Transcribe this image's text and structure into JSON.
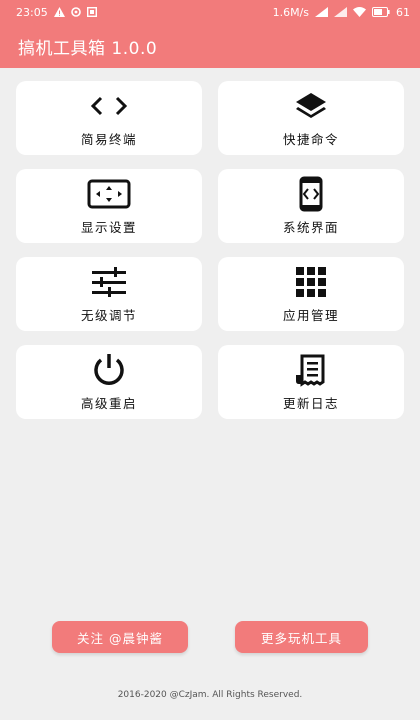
{
  "status_bar": {
    "time": "23:05",
    "network_speed": "1.6M/s",
    "battery": "61",
    "icons": [
      "warning-icon",
      "sync-icon",
      "notification-icon",
      "signal-icon",
      "wifi-icon",
      "battery-icon"
    ]
  },
  "app_bar": {
    "title": "搞机工具箱 1.0.0"
  },
  "tiles": [
    {
      "label": "简易终端",
      "icon": "code-icon"
    },
    {
      "label": "快捷命令",
      "icon": "layers-icon"
    },
    {
      "label": "显示设置",
      "icon": "screen-expand-icon"
    },
    {
      "label": "系统界面",
      "icon": "phone-code-icon"
    },
    {
      "label": "无级调节",
      "icon": "sliders-icon"
    },
    {
      "label": "应用管理",
      "icon": "apps-grid-icon"
    },
    {
      "label": "高级重启",
      "icon": "power-icon"
    },
    {
      "label": "更新日志",
      "icon": "receipt-icon"
    }
  ],
  "buttons": {
    "follow": "关注 @晨钟酱",
    "more_tools": "更多玩机工具"
  },
  "footer": {
    "copyright": "2016-2020 @CzJam. All Rights Reserved."
  },
  "colors": {
    "accent": "#f27b7b",
    "background": "#efefef",
    "tile": "#ffffff"
  }
}
